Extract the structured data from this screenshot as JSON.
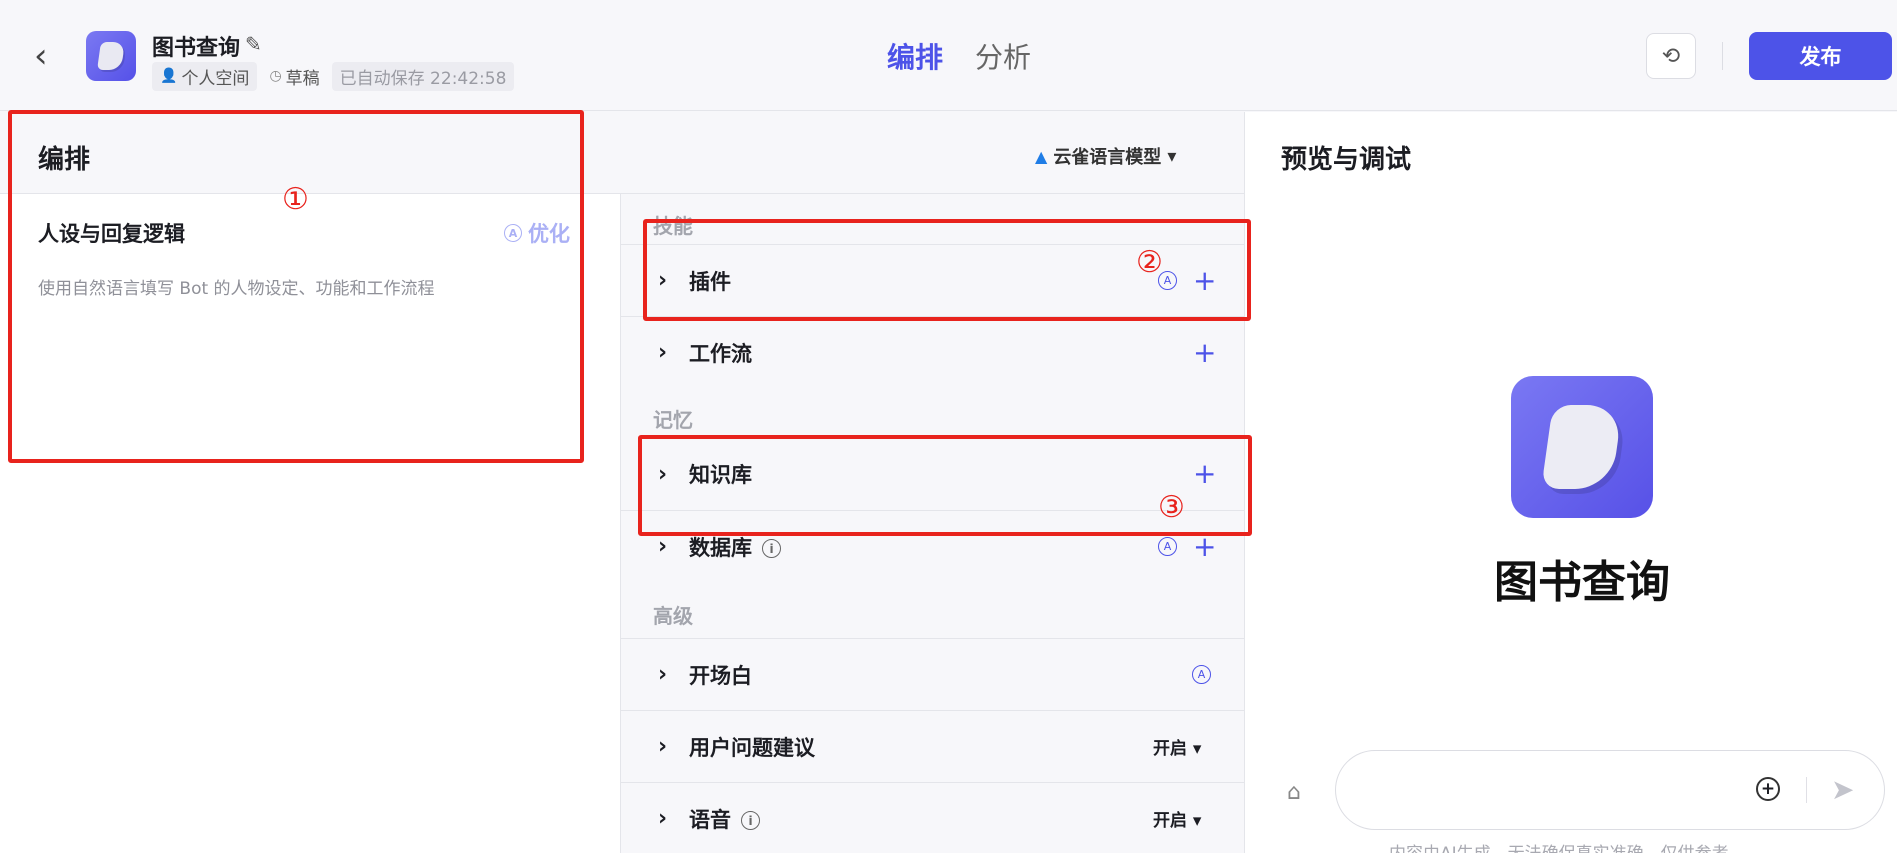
{
  "header": {
    "bot_name": "图书查询",
    "space": "个人空间",
    "status": "草稿",
    "autosave": "已自动保存 22:42:58",
    "tabs": [
      "编排",
      "分析"
    ],
    "publish": "发布"
  },
  "arrange": {
    "title": "编排",
    "model": "云雀语言模型",
    "persona_title": "人设与回复逻辑",
    "optimize": "优化",
    "persona_placeholder": "使用自然语言填写 Bot 的人物设定、功能和工作流程"
  },
  "groups": {
    "skills": "技能",
    "memory": "记忆",
    "advanced": "高级"
  },
  "rows": {
    "plugins": "插件",
    "workflow": "工作流",
    "knowledge": "知识库",
    "database": "数据库",
    "opening": "开场白",
    "suggestions": "用户问题建议",
    "voice": "语音",
    "suggestions_value": "开启",
    "voice_value": "开启"
  },
  "preview": {
    "title": "预览与调试",
    "bot_name": "图书查询",
    "disclaimer": "内容由AI生成，无法确保真实准确，仅供参考"
  },
  "annotations": [
    "①",
    "②",
    "③"
  ],
  "colors": {
    "accent": "#4d53e8",
    "annotation": "#e8231d"
  }
}
